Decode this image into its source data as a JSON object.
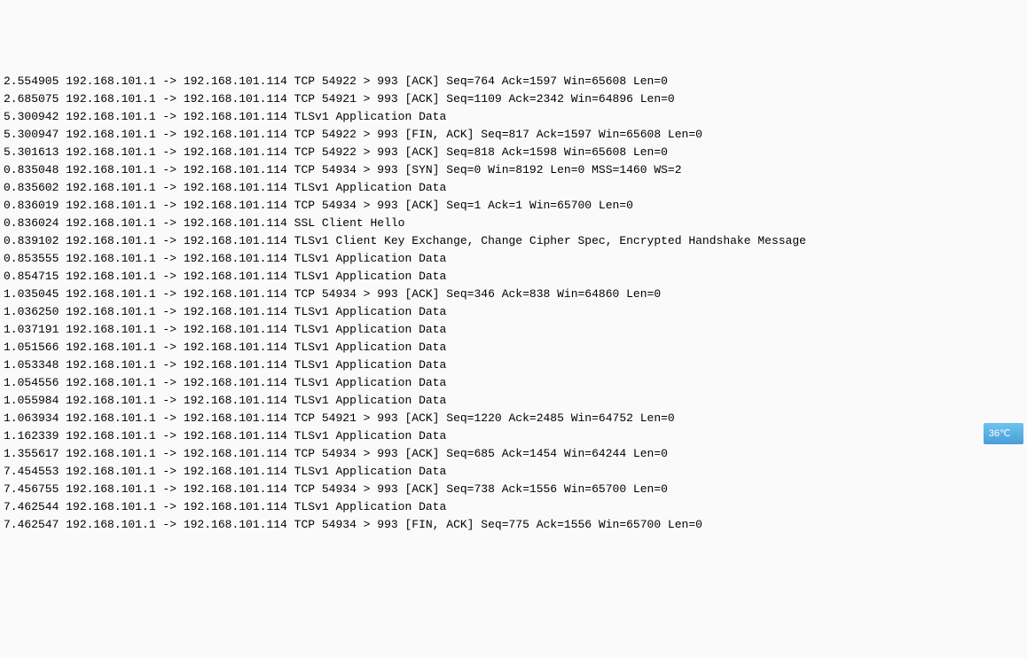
{
  "packets": [
    {
      "time": "2.554905",
      "src": "192.168.101.1",
      "dst": "192.168.101.114",
      "proto": "TCP",
      "info": "54922 > 993 [ACK] Seq=764 Ack=1597 Win=65608 Len=0"
    },
    {
      "time": "2.685075",
      "src": "192.168.101.1",
      "dst": "192.168.101.114",
      "proto": "TCP",
      "info": "54921 > 993 [ACK] Seq=1109 Ack=2342 Win=64896 Len=0"
    },
    {
      "time": "5.300942",
      "src": "192.168.101.1",
      "dst": "192.168.101.114",
      "proto": "TLSv1",
      "info": "Application Data"
    },
    {
      "time": "5.300947",
      "src": "192.168.101.1",
      "dst": "192.168.101.114",
      "proto": "TCP",
      "info": "54922 > 993 [FIN, ACK] Seq=817 Ack=1597 Win=65608 Len=0"
    },
    {
      "time": "5.301613",
      "src": "192.168.101.1",
      "dst": "192.168.101.114",
      "proto": "TCP",
      "info": "54922 > 993 [ACK] Seq=818 Ack=1598 Win=65608 Len=0"
    },
    {
      "time": "0.835048",
      "src": "192.168.101.1",
      "dst": "192.168.101.114",
      "proto": "TCP",
      "info": "54934 > 993 [SYN] Seq=0 Win=8192 Len=0 MSS=1460 WS=2"
    },
    {
      "time": "0.835602",
      "src": "192.168.101.1",
      "dst": "192.168.101.114",
      "proto": "TLSv1",
      "info": "Application Data"
    },
    {
      "time": "0.836019",
      "src": "192.168.101.1",
      "dst": "192.168.101.114",
      "proto": "TCP",
      "info": "54934 > 993 [ACK] Seq=1 Ack=1 Win=65700 Len=0"
    },
    {
      "time": "0.836024",
      "src": "192.168.101.1",
      "dst": "192.168.101.114",
      "proto": "SSL",
      "info": "Client Hello"
    },
    {
      "time": "0.839102",
      "src": "192.168.101.1",
      "dst": "192.168.101.114",
      "proto": "TLSv1",
      "info": "Client Key Exchange, Change Cipher Spec, Encrypted Handshake Message"
    },
    {
      "time": "0.853555",
      "src": "192.168.101.1",
      "dst": "192.168.101.114",
      "proto": "TLSv1",
      "info": "Application Data"
    },
    {
      "time": "0.854715",
      "src": "192.168.101.1",
      "dst": "192.168.101.114",
      "proto": "TLSv1",
      "info": "Application Data"
    },
    {
      "time": "1.035045",
      "src": "192.168.101.1",
      "dst": "192.168.101.114",
      "proto": "TCP",
      "info": "54934 > 993 [ACK] Seq=346 Ack=838 Win=64860 Len=0"
    },
    {
      "time": "1.036250",
      "src": "192.168.101.1",
      "dst": "192.168.101.114",
      "proto": "TLSv1",
      "info": "Application Data"
    },
    {
      "time": "1.037191",
      "src": "192.168.101.1",
      "dst": "192.168.101.114",
      "proto": "TLSv1",
      "info": "Application Data"
    },
    {
      "time": "1.051566",
      "src": "192.168.101.1",
      "dst": "192.168.101.114",
      "proto": "TLSv1",
      "info": "Application Data"
    },
    {
      "time": "1.053348",
      "src": "192.168.101.1",
      "dst": "192.168.101.114",
      "proto": "TLSv1",
      "info": "Application Data"
    },
    {
      "time": "1.054556",
      "src": "192.168.101.1",
      "dst": "192.168.101.114",
      "proto": "TLSv1",
      "info": "Application Data"
    },
    {
      "time": "1.055984",
      "src": "192.168.101.1",
      "dst": "192.168.101.114",
      "proto": "TLSv1",
      "info": "Application Data"
    },
    {
      "time": "1.063934",
      "src": "192.168.101.1",
      "dst": "192.168.101.114",
      "proto": "TCP",
      "info": "54921 > 993 [ACK] Seq=1220 Ack=2485 Win=64752 Len=0"
    },
    {
      "time": "1.162339",
      "src": "192.168.101.1",
      "dst": "192.168.101.114",
      "proto": "TLSv1",
      "info": "Application Data"
    },
    {
      "time": "1.355617",
      "src": "192.168.101.1",
      "dst": "192.168.101.114",
      "proto": "TCP",
      "info": "54934 > 993 [ACK] Seq=685 Ack=1454 Win=64244 Len=0"
    },
    {
      "time": "7.454553",
      "src": "192.168.101.1",
      "dst": "192.168.101.114",
      "proto": "TLSv1",
      "info": "Application Data"
    },
    {
      "time": "7.456755",
      "src": "192.168.101.1",
      "dst": "192.168.101.114",
      "proto": "TCP",
      "info": "54934 > 993 [ACK] Seq=738 Ack=1556 Win=65700 Len=0"
    },
    {
      "time": "7.462544",
      "src": "192.168.101.1",
      "dst": "192.168.101.114",
      "proto": "TLSv1",
      "info": "Application Data"
    },
    {
      "time": "7.462547",
      "src": "192.168.101.1",
      "dst": "192.168.101.114",
      "proto": "TCP",
      "info": "54934 > 993 [FIN, ACK] Seq=775 Ack=1556 Win=65700 Len=0"
    }
  ],
  "weather": {
    "temp": "36℃",
    "arrow": "↓"
  }
}
